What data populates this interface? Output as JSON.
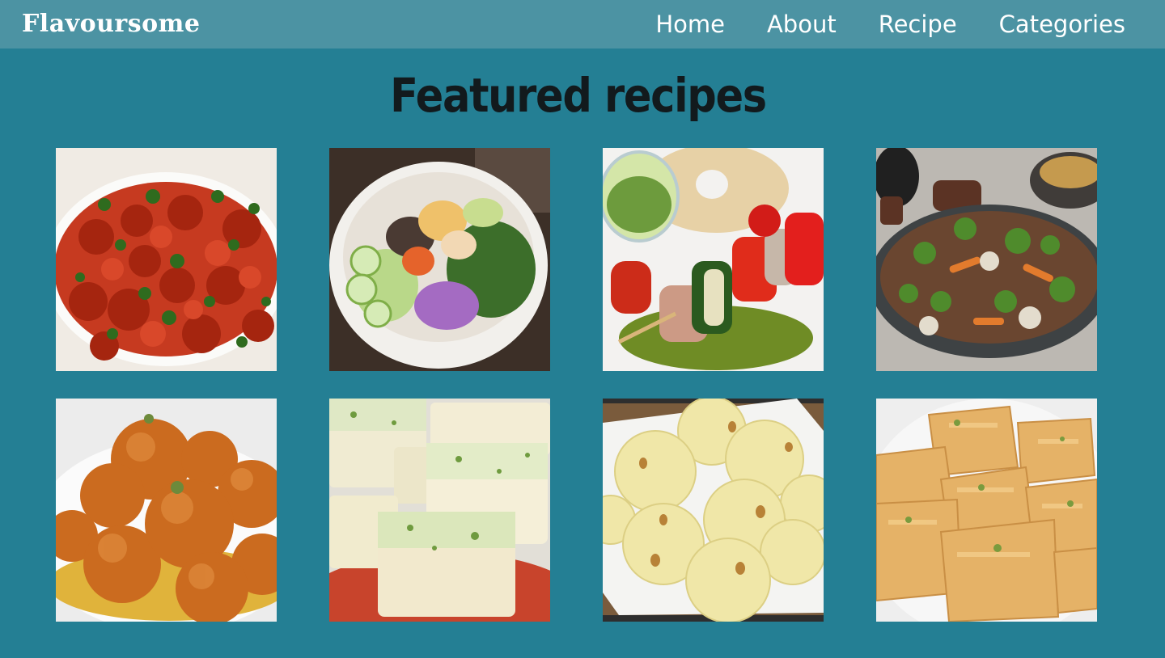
{
  "brand": "Flavoursome",
  "nav": [
    "Home",
    "About",
    "Recipe",
    "Categories"
  ],
  "title": "Featured recipes",
  "recipes": [
    {
      "name": "chilli-chicken",
      "icon": "chilli-chicken-photo"
    },
    {
      "name": "veggie-bowl",
      "icon": "salad-bowl-photo"
    },
    {
      "name": "grilled-skewers",
      "icon": "skewers-photo"
    },
    {
      "name": "beef-broccoli",
      "icon": "stir-fry-photo"
    },
    {
      "name": "gulab-jamun",
      "icon": "gulab-jamun-photo"
    },
    {
      "name": "barfi",
      "icon": "barfi-photo"
    },
    {
      "name": "rava-laddu",
      "icon": "laddu-photo"
    },
    {
      "name": "soan-papdi",
      "icon": "soan-papdi-photo"
    }
  ]
}
